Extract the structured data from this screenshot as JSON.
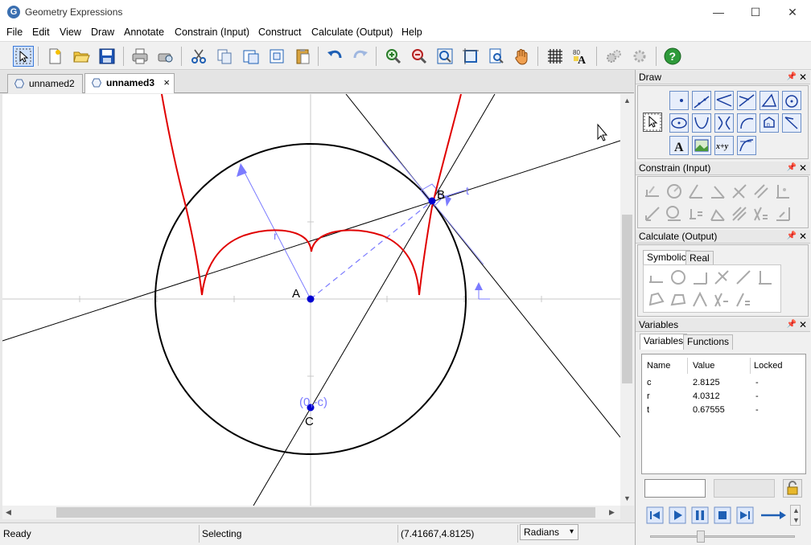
{
  "window": {
    "title": "Geometry Expressions",
    "minimize": "—",
    "maximize": "☐",
    "close": "✕"
  },
  "menu": [
    "File",
    "Edit",
    "View",
    "Draw",
    "Annotate",
    "Constrain (Input)",
    "Construct",
    "Calculate (Output)",
    "Help"
  ],
  "tabs": [
    {
      "label": "unnamed2",
      "active": false
    },
    {
      "label": "unnamed3",
      "active": true,
      "close": "×"
    }
  ],
  "canvas": {
    "labels": {
      "point_a": "A",
      "point_b": "B",
      "point_c": "C",
      "coord_c": "(0,-c)",
      "radius": "r",
      "param": "t"
    }
  },
  "panels": {
    "draw": {
      "title": "Draw"
    },
    "constrain": {
      "title": "Constrain (Input)"
    },
    "calculate": {
      "title": "Calculate (Output)",
      "tabs": [
        "Symbolic",
        "Real"
      ]
    },
    "variables": {
      "title": "Variables",
      "tabs": [
        "Variables",
        "Functions"
      ],
      "columns": [
        "Name",
        "Value",
        "Locked"
      ],
      "rows": [
        {
          "name": "c",
          "value": "2.8125",
          "locked": "-"
        },
        {
          "name": "r",
          "value": "4.0312",
          "locked": "-"
        },
        {
          "name": "t",
          "value": "0.67555",
          "locked": "-"
        }
      ]
    }
  },
  "status": {
    "state": "Ready",
    "mode": "Selecting",
    "coords": "(7.41667,4.8125)",
    "units": "Radians"
  },
  "colors": {
    "accent": "#3b7ad9",
    "curve": "#e00000",
    "annotation": "#7b7bff",
    "point": "#0000d0"
  }
}
